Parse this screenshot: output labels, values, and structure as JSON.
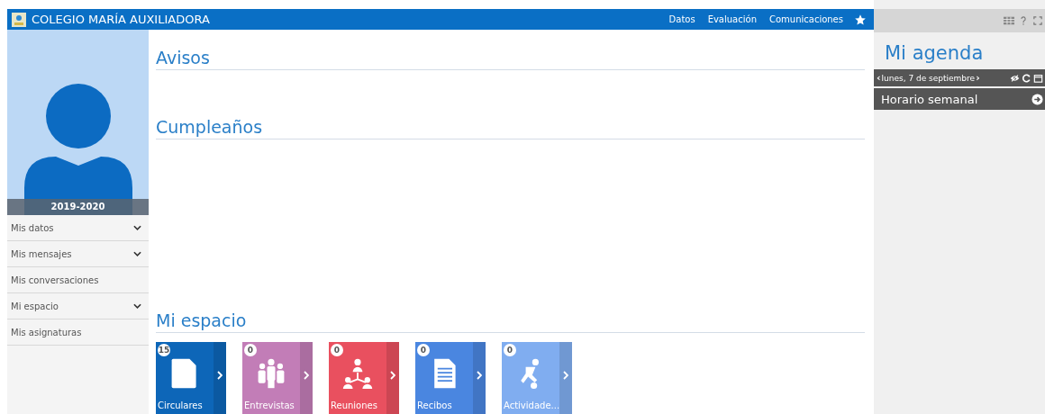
{
  "header": {
    "title": "COLEGIO MARÍA AUXILIADORA",
    "nav": [
      "Datos",
      "Evaluación",
      "Comunicaciones"
    ]
  },
  "profile": {
    "year": "2019-2020"
  },
  "menu": [
    {
      "label": "Mis datos",
      "expandable": true
    },
    {
      "label": "Mis mensajes",
      "expandable": true
    },
    {
      "label": "Mis conversaciones",
      "expandable": false
    },
    {
      "label": "Mi espacio",
      "expandable": true
    },
    {
      "label": "Mis asignaturas",
      "expandable": false
    }
  ],
  "sections": {
    "notices": "Avisos",
    "birthdays": "Cumpleaños",
    "space": "Mi espacio"
  },
  "tiles": [
    {
      "kind": "document",
      "label": "Circulares",
      "count": "15",
      "color": "#0d66b8"
    },
    {
      "kind": "people",
      "label": "Entrevistas",
      "count": "0",
      "color": "#c27db7"
    },
    {
      "kind": "meeting",
      "label": "Reuniones",
      "count": "0",
      "color": "#e9505f"
    },
    {
      "kind": "receipt",
      "label": "Recibos",
      "count": "0",
      "color": "#4a86e0"
    },
    {
      "kind": "activity",
      "label": "Actividade...",
      "count": "0",
      "color": "#80adf0"
    }
  ],
  "agenda": {
    "title": "Mi agenda",
    "date": "lunes, 7 de septiembre",
    "prev": "‹",
    "next": "›",
    "schedule": "Horario semanal"
  }
}
